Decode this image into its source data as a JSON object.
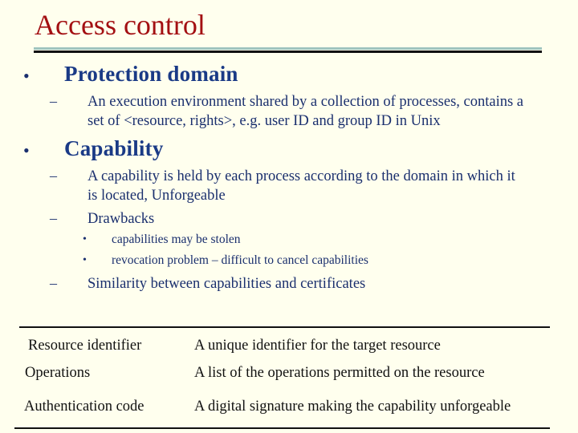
{
  "slide": {
    "title": "Access control",
    "bullets": [
      {
        "heading": "Protection domain",
        "subitems": [
          {
            "lines": [
              "An execution environment shared by a collection of processes, contains a",
              "set of <resource, rights>, e.g. user ID and group ID in Unix"
            ]
          }
        ]
      },
      {
        "heading": "Capability",
        "subitems": [
          {
            "lines": [
              "A capability is held by each process according to the domain in which it",
              "is located, Unforgeable"
            ]
          },
          {
            "lines": [
              "Drawbacks"
            ],
            "subitems": [
              "capabilities may be stolen",
              "revocation problem – difficult to cancel capabilities"
            ]
          },
          {
            "lines": [
              "Similarity between capabilities and certificates"
            ]
          }
        ]
      }
    ],
    "bullet_glyph": "•",
    "dash_glyph": "–"
  },
  "table": {
    "rows": [
      {
        "field": "Resource identifier",
        "description": "A unique identifier for the target resource"
      },
      {
        "field": "Operations",
        "description": "A list of the operations permitted on the resource"
      },
      {
        "field": "Authentication code",
        "description": "A digital signature making the capability unforgeable"
      }
    ]
  },
  "colors": {
    "title": "#A30F12",
    "heading": "#1A3A86",
    "body": "#1A2F6E",
    "background": "#FFFFEE"
  }
}
